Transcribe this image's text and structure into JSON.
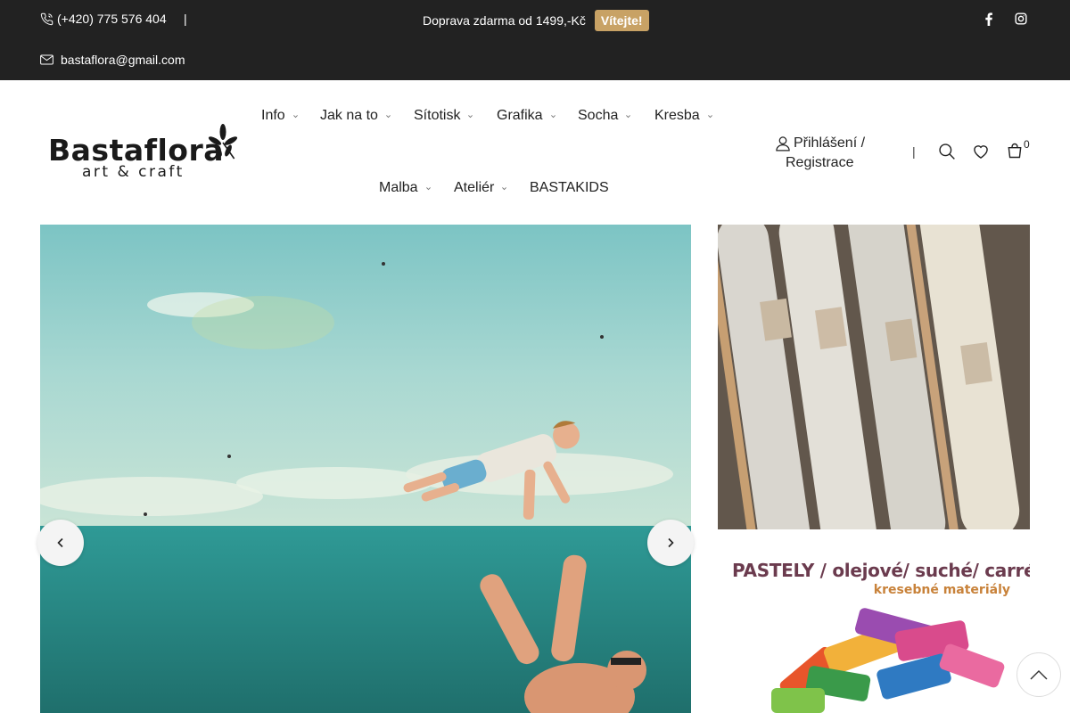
{
  "topbar": {
    "phone": "(+420) 775 576 404",
    "separator": "|",
    "email": "bastaflora@gmail.com",
    "promo_text": "Doprava zdarma od 1499,-Kč",
    "promo_badge": "Vítejte!",
    "social": [
      "facebook-icon",
      "instagram-icon"
    ]
  },
  "header": {
    "logo_alt": "Bastaflora art & craft",
    "nav": [
      {
        "label": "Info",
        "has_submenu": true
      },
      {
        "label": "Jak na to",
        "has_submenu": true
      },
      {
        "label": "Sítotisk",
        "has_submenu": true
      },
      {
        "label": "Grafika",
        "has_submenu": true
      },
      {
        "label": "Socha",
        "has_submenu": true
      },
      {
        "label": "Kresba",
        "has_submenu": true
      },
      {
        "label": "Malba",
        "has_submenu": true
      },
      {
        "label": "Ateliér",
        "has_submenu": true
      },
      {
        "label": "BASTAKIDS",
        "has_submenu": false
      }
    ],
    "account_line1": "Přihlášení /",
    "account_line2": "Registrace",
    "separator": "|",
    "cart_count": "0"
  },
  "banners": {
    "pastels_title": "PASTELY / olejové/ suché/  carré",
    "pastels_subtitle": "kresebné materiály"
  },
  "colors": {
    "topbar_bg": "#222222",
    "badge_bg": "#c8a265",
    "pastels_title": "#6b3b4e",
    "pastels_subtitle": "#c8823a"
  }
}
